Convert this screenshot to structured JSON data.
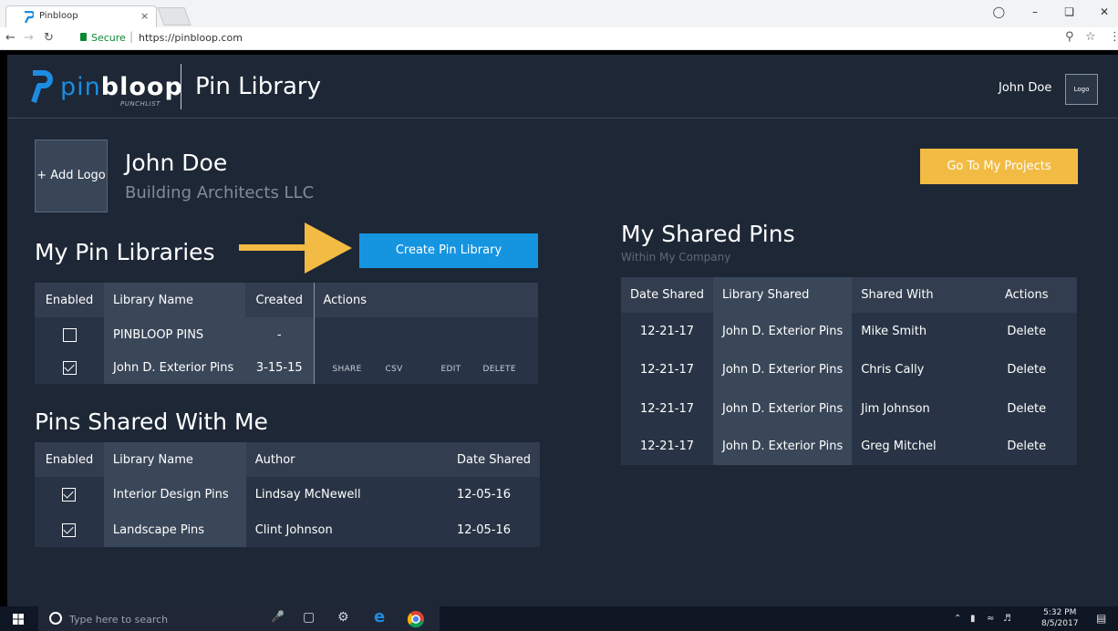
{
  "browser": {
    "tab_title": "Pinbloop",
    "tab_close": "×",
    "secure_label": "Secure",
    "url": "https://pinbloop.com"
  },
  "header": {
    "logo_pin": "pin",
    "logo_bloop": "bloop",
    "logo_sub": "PUNCHLIST",
    "page_title": "Pin Library",
    "user_name": "John Doe",
    "user_logo": "Logo"
  },
  "profile": {
    "add_logo": "+ Add Logo",
    "name": "John Doe",
    "company": "Building Architects LLC",
    "projects_button": "Go To My Projects"
  },
  "my_libraries": {
    "title": "My Pin Libraries",
    "create_button": "Create Pin Library",
    "headers": [
      "Enabled",
      "Library Name",
      "Created",
      "Actions"
    ],
    "rows": [
      {
        "enabled": false,
        "name": "PINBLOOP  PINS",
        "created": "-"
      },
      {
        "enabled": true,
        "name": "John D. Exterior Pins",
        "created": "3-15-15",
        "actions": [
          "SHARE",
          "CSV",
          "EDIT",
          "DELETE"
        ]
      }
    ]
  },
  "shared_with_me": {
    "title": "Pins Shared With Me",
    "headers": [
      "Enabled",
      "Library Name",
      "Author",
      "Date Shared"
    ],
    "rows": [
      {
        "enabled": true,
        "name": "Interior Design Pins",
        "author": "Lindsay McNewell",
        "date": "12-05-16"
      },
      {
        "enabled": true,
        "name": "Landscape Pins",
        "author": "Clint Johnson",
        "date": "12-05-16"
      }
    ]
  },
  "my_shared": {
    "title": "My Shared Pins",
    "subtitle": "Within My Company",
    "headers": [
      "Date Shared",
      "Library Shared",
      "Shared With",
      "Actions"
    ],
    "rows": [
      {
        "date": "12-21-17",
        "library": "John D. Exterior Pins",
        "with": "Mike Smith",
        "action": "Delete"
      },
      {
        "date": "12-21-17",
        "library": "John D. Exterior Pins",
        "with": "Chris Cally",
        "action": "Delete"
      },
      {
        "date": "12-21-17",
        "library": "John D. Exterior Pins",
        "with": "Jim Johnson",
        "action": "Delete"
      },
      {
        "date": "12-21-17",
        "library": "John D. Exterior Pins",
        "with": "Greg Mitchel",
        "action": "Delete"
      }
    ]
  },
  "taskbar": {
    "search_placeholder": "Type here to search",
    "time": "5:32 PM",
    "date": "8/5/2017"
  },
  "colors": {
    "background": "#1d2736",
    "accent_blue": "#1594e0",
    "accent_yellow": "#f2bb43"
  }
}
